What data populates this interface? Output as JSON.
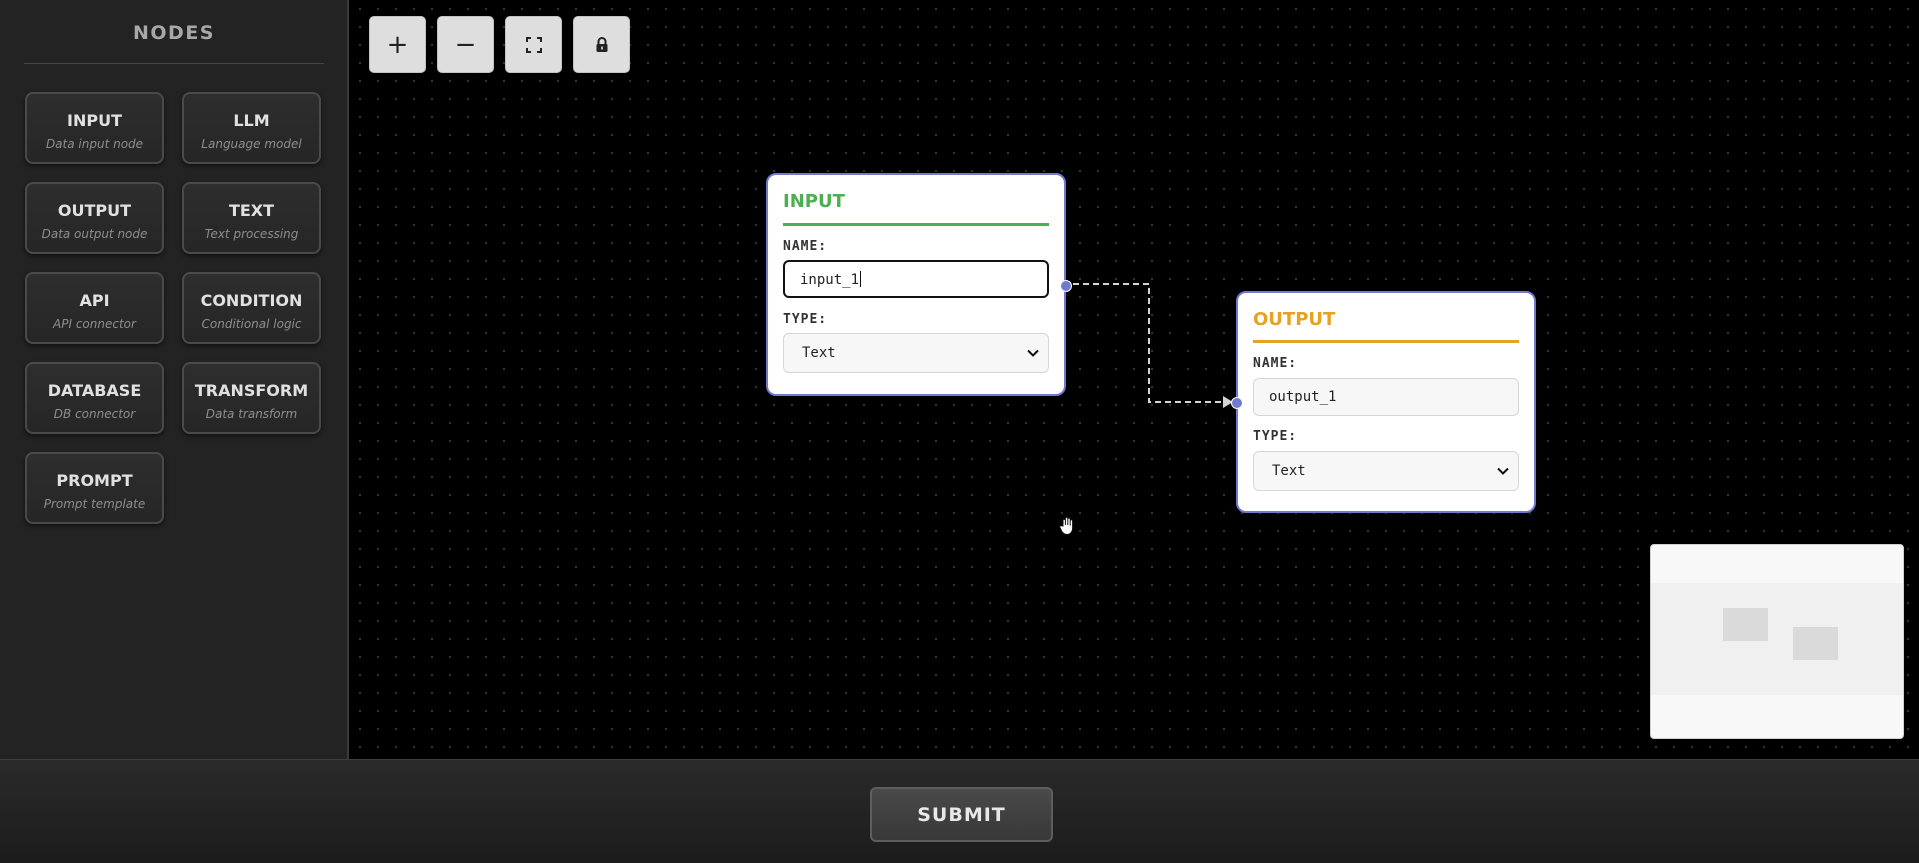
{
  "sidebar": {
    "title": "NODES",
    "nodes": [
      {
        "label": "INPUT",
        "description": "Data input node",
        "icon": "input-node"
      },
      {
        "label": "LLM",
        "description": "Language model",
        "icon": "llm-node"
      },
      {
        "label": "OUTPUT",
        "description": "Data output node",
        "icon": "output-node"
      },
      {
        "label": "TEXT",
        "description": "Text processing",
        "icon": "text-node"
      },
      {
        "label": "API",
        "description": "API connector",
        "icon": "api-node"
      },
      {
        "label": "CONDITION",
        "description": "Conditional logic",
        "icon": "condition-node"
      },
      {
        "label": "DATABASE",
        "description": "DB connector",
        "icon": "database-node"
      },
      {
        "label": "TRANSFORM",
        "description": "Data transform",
        "icon": "transform-node"
      },
      {
        "label": "PROMPT",
        "description": "Prompt template",
        "icon": "prompt-node"
      }
    ]
  },
  "controls": {
    "zoom_in": "+",
    "zoom_out": "−",
    "fit_view_icon": "fit-view-icon",
    "lock_icon": "lock-icon"
  },
  "flow": {
    "input_node": {
      "title": "INPUT",
      "title_color": "#4caf50",
      "name_label": "NAME:",
      "name_value": "input_1",
      "type_label": "TYPE:",
      "type_value": "Text"
    },
    "output_node": {
      "title": "OUTPUT",
      "title_color": "#e5a321",
      "name_label": "NAME:",
      "name_value": "output_1",
      "type_label": "TYPE:",
      "type_value": "Text"
    }
  },
  "footer": {
    "submit_label": "SUBMIT"
  },
  "colors": {
    "accent": "#6f7ad0",
    "sidebar_bg": "#232323",
    "canvas_bg": "#000000"
  }
}
